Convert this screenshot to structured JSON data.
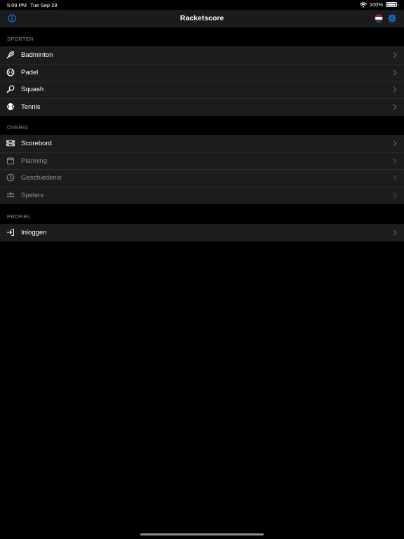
{
  "status": {
    "time": "5:09 PM",
    "date": "Tue Sep 28",
    "battery": "100%"
  },
  "nav": {
    "title": "Racketscore"
  },
  "sections": {
    "sporten": {
      "header": "SPORTEN",
      "items": [
        {
          "label": "Badminton",
          "icon": "shuttlecock-icon"
        },
        {
          "label": "Padel",
          "icon": "padel-ball-icon"
        },
        {
          "label": "Squash",
          "icon": "squash-racket-icon"
        },
        {
          "label": "Tennis",
          "icon": "tennis-ball-icon"
        }
      ]
    },
    "overig": {
      "header": "OVERIG",
      "items": [
        {
          "label": "Scorebord",
          "icon": "scoreboard-icon",
          "enabled": true
        },
        {
          "label": "Planning",
          "icon": "calendar-icon",
          "enabled": false
        },
        {
          "label": "Geschiedenis",
          "icon": "clock-icon",
          "enabled": false
        },
        {
          "label": "Spelers",
          "icon": "players-icon",
          "enabled": false
        }
      ]
    },
    "profiel": {
      "header": "PROFIEL",
      "items": [
        {
          "label": "Inloggen",
          "icon": "login-icon"
        }
      ]
    }
  },
  "colors": {
    "accent": "#0a84ff",
    "background": "#000000",
    "cell": "#1c1c1e",
    "secondary_text": "#8e8e93"
  }
}
